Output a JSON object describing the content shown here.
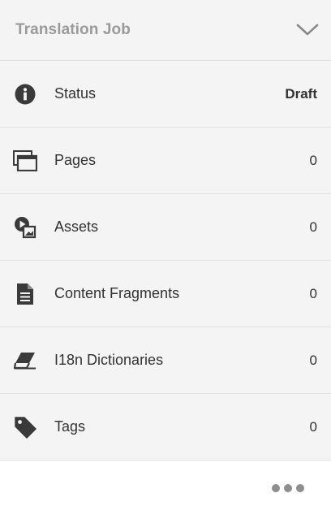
{
  "card": {
    "title": "Translation Job",
    "collapse_icon": "chevron-down-icon"
  },
  "rows": [
    {
      "icon": "info-icon",
      "label": "Status",
      "value": "Draft"
    },
    {
      "icon": "pages-icon",
      "label": "Pages",
      "value": "0"
    },
    {
      "icon": "assets-icon",
      "label": "Assets",
      "value": "0"
    },
    {
      "icon": "document-icon",
      "label": "Content Fragments",
      "value": "0"
    },
    {
      "icon": "eraser-icon",
      "label": "I18n Dictionaries",
      "value": "0"
    },
    {
      "icon": "tag-icon",
      "label": "Tags",
      "value": "0"
    }
  ],
  "footer": {
    "more_icon": "more-icon"
  },
  "colors": {
    "panel_bg": "#f4f4f4",
    "divider": "#e1e1e1",
    "text": "#323232",
    "title_muted": "#9a9a9a",
    "icon": "#3a3a3a"
  }
}
